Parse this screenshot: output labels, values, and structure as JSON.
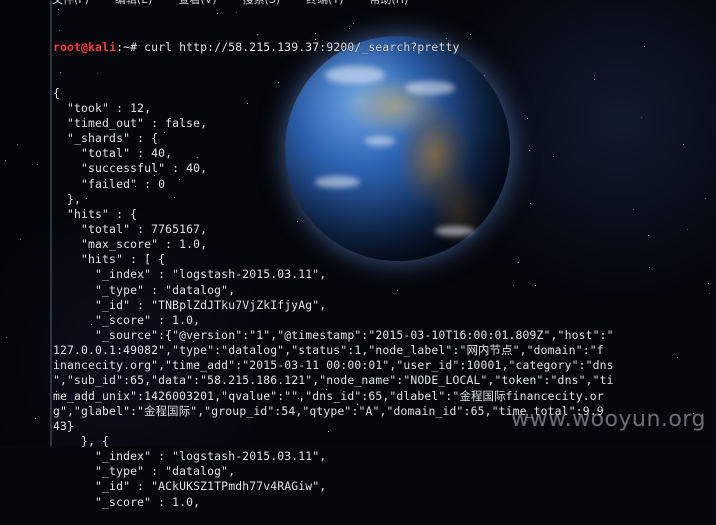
{
  "menu": {
    "items": [
      "文件(F)",
      "编辑(E)",
      "查看(V)",
      "搜索(S)",
      "终端(T)",
      "帮助(H)"
    ]
  },
  "prompt": {
    "user": "root",
    "at": "@",
    "host": "kali",
    "path": ":~#",
    "command": " curl http://58.215.139.37:9200/_search?pretty"
  },
  "output_lines": [
    "{",
    "  \"took\" : 12,",
    "  \"timed_out\" : false,",
    "  \"_shards\" : {",
    "    \"total\" : 40,",
    "    \"successful\" : 40,",
    "    \"failed\" : 0",
    "  },",
    "  \"hits\" : {",
    "    \"total\" : 7765167,",
    "    \"max_score\" : 1.0,",
    "    \"hits\" : [ {",
    "      \"_index\" : \"logstash-2015.03.11\",",
    "      \"_type\" : \"datalog\",",
    "      \"_id\" : \"TNBplZdJTku7VjZkIfjyAg\",",
    "      \"_score\" : 1.0,",
    "      \"_source\":{\"@version\":\"1\",\"@timestamp\":\"2015-03-10T16:00:01.809Z\",\"host\":\"",
    "127.0.0.1:49082\",\"type\":\"datalog\",\"status\":1,\"node_label\":\"网内节点\",\"domain\":\"f",
    "inancecity.org\",\"time_add\":\"2015-03-11 00:00:01\",\"user_id\":10001,\"category\":\"dns",
    "\",\"sub_id\":65,\"data\":\"58.215.186.121\",\"node_name\":\"NODE_LOCAL\",\"token\":\"dns\",\"ti",
    "me_add_unix\":1426003201,\"qvalue\":\"\",\"dns_id\":65,\"dlabel\":\"金程国际financecity.or",
    "g\",\"glabel\":\"金程国际\",\"group_id\":54,\"qtype\":\"A\",\"domain_id\":65,\"time_total\":9.9",
    "43}",
    "    }, {",
    "      \"_index\" : \"logstash-2015.03.11\",",
    "      \"_type\" : \"datalog\",",
    "      \"_id\" : \"ACkUKSZ1TPmdh77v4RAGiw\",",
    "      \"_score\" : 1.0,"
  ],
  "watermark": "www.wooyun.org"
}
